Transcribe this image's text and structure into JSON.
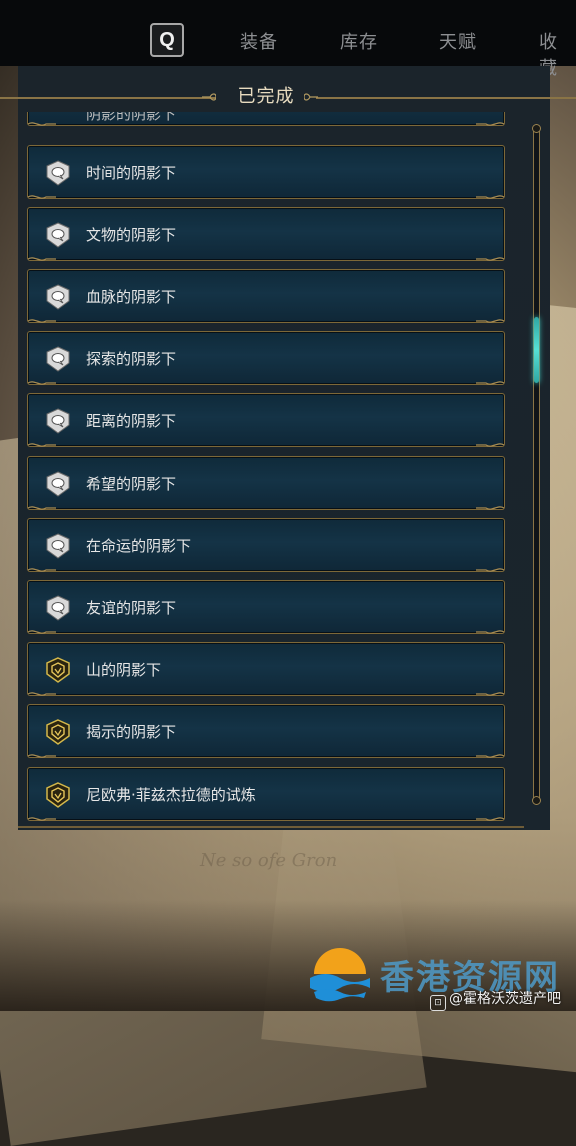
{
  "tabs": {
    "search_glyph": "Q",
    "items": [
      {
        "label": "装备"
      },
      {
        "label": "库存"
      },
      {
        "label": "天赋"
      },
      {
        "label": "收藏"
      }
    ]
  },
  "panel": {
    "title": "已完成"
  },
  "list": {
    "items": [
      {
        "label": "阴影的阴影下",
        "icon": "speech-bubble-icon"
      },
      {
        "label": "时间的阴影下",
        "icon": "speech-bubble-icon"
      },
      {
        "label": "文物的阴影下",
        "icon": "speech-bubble-icon"
      },
      {
        "label": "血脉的阴影下",
        "icon": "speech-bubble-icon"
      },
      {
        "label": "探索的阴影下",
        "icon": "speech-bubble-icon"
      },
      {
        "label": "距离的阴影下",
        "icon": "speech-bubble-icon"
      },
      {
        "label": "希望的阴影下",
        "icon": "speech-bubble-icon"
      },
      {
        "label": "在命运的阴影下",
        "icon": "speech-bubble-icon"
      },
      {
        "label": "友谊的阴影下",
        "icon": "speech-bubble-icon"
      },
      {
        "label": "山的阴影下",
        "icon": "shield-icon"
      },
      {
        "label": "揭示的阴影下",
        "icon": "shield-icon"
      },
      {
        "label": "尼欧弗·菲兹杰拉德的试炼",
        "icon": "shield-icon"
      }
    ]
  },
  "scrollbar": {
    "position_fraction": 0.31
  },
  "watermark": {
    "site": "香港资源网",
    "handle": "@霍格沃茨遗产吧"
  },
  "colors": {
    "gold_border": "#7d6838",
    "item_bg": "#143346",
    "scroll_thumb": "#56e0d4",
    "tab_text": "#8d8f92"
  }
}
